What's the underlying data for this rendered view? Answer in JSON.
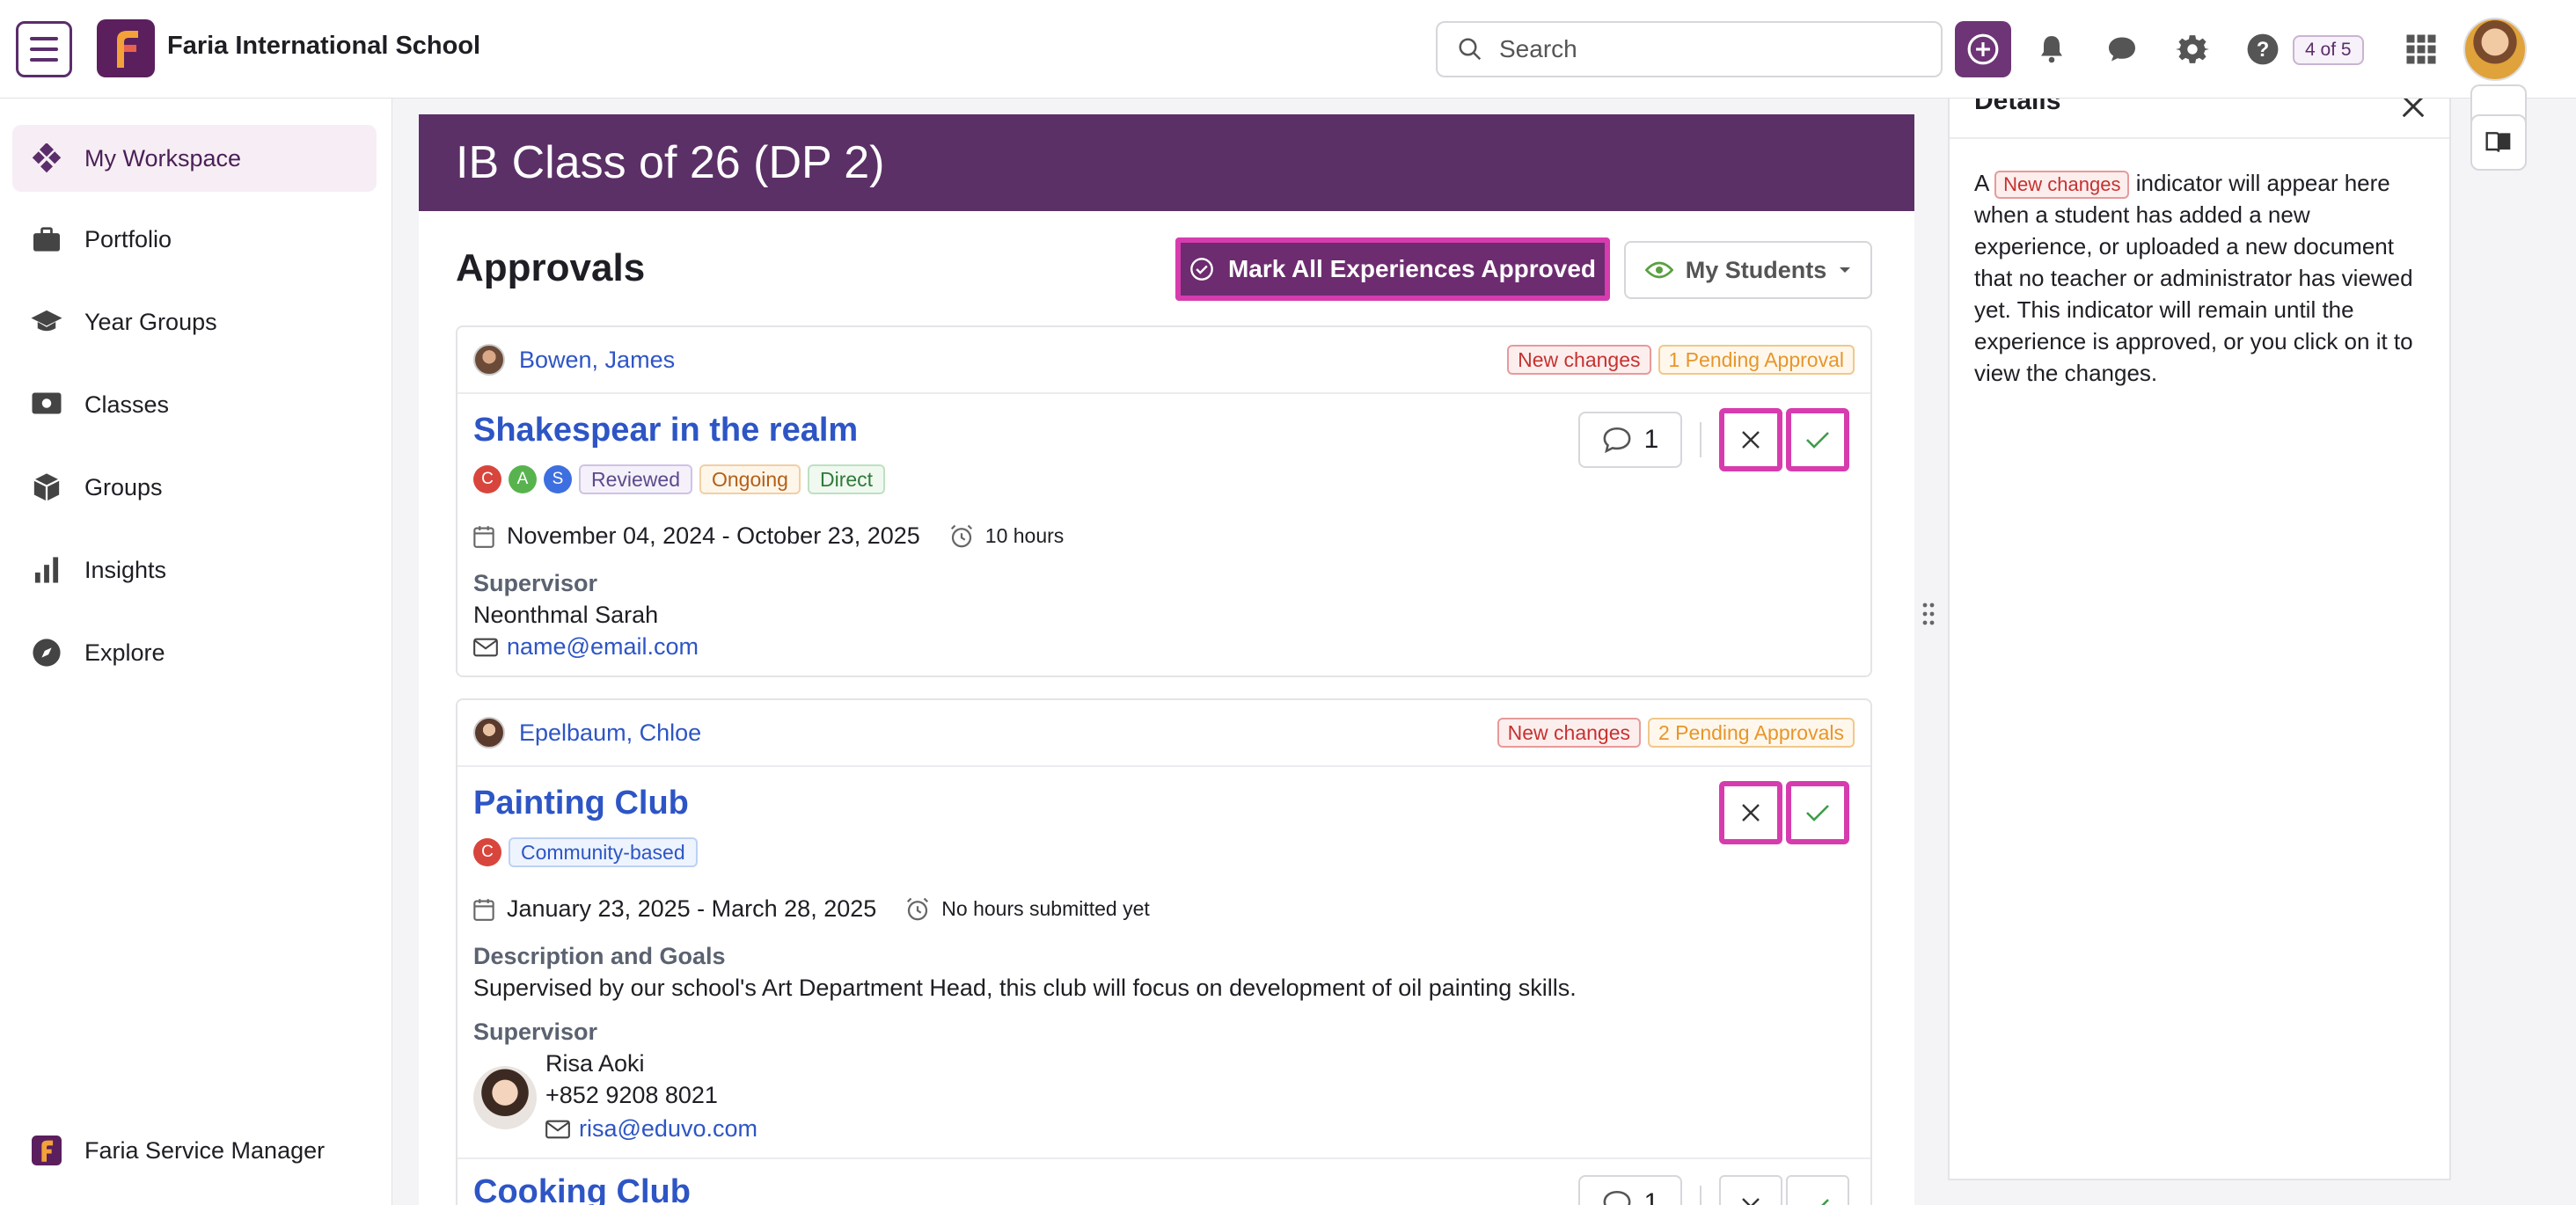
{
  "app": {
    "title": "Faria International School"
  },
  "header": {
    "search_placeholder": "Search",
    "page_counter": "4 of 5"
  },
  "sidebar": {
    "items": [
      {
        "label": "My Workspace",
        "icon": "workspace-icon",
        "active": true
      },
      {
        "label": "Portfolio",
        "icon": "briefcase-icon"
      },
      {
        "label": "Year Groups",
        "icon": "graduation-cap-icon"
      },
      {
        "label": "Classes",
        "icon": "classes-icon"
      },
      {
        "label": "Groups",
        "icon": "cube-icon"
      },
      {
        "label": "Insights",
        "icon": "bar-chart-icon"
      },
      {
        "label": "Explore",
        "icon": "compass-icon"
      }
    ],
    "footer": {
      "label": "Faria Service Manager"
    }
  },
  "main": {
    "banner_title": "IB Class of 26 (DP 2)",
    "section_title": "Approvals",
    "mark_all_label": "Mark All Experiences Approved",
    "filter_label": "My Students",
    "cards": [
      {
        "student": "Bowen, James",
        "badge_new": "New changes",
        "badge_pending": "1 Pending Approval",
        "title": "Shakespear in the realm",
        "dots": [
          "C",
          "A",
          "S"
        ],
        "tags": [
          "Reviewed",
          "Ongoing",
          "Direct"
        ],
        "dates": "November 04, 2024 - October 23, 2025",
        "hours": "10 hours",
        "comments": "1",
        "supervisor_label": "Supervisor",
        "supervisor_name": "Neonthmal Sarah",
        "supervisor_email": "name@email.com"
      },
      {
        "student": "Epelbaum, Chloe",
        "badge_new": "New changes",
        "badge_pending": "2 Pending Approvals",
        "title": "Painting Club",
        "dots": [
          "C"
        ],
        "tags": [
          "Community-based"
        ],
        "dates": "January 23, 2025 - March 28, 2025",
        "hours": "No hours submitted yet",
        "desc_label": "Description and Goals",
        "desc": "Supervised by our school's Art Department Head, this club will focus on development of oil painting skills.",
        "supervisor_label": "Supervisor",
        "supervisor_name": "Risa Aoki",
        "supervisor_phone": "+852 9208 8021",
        "supervisor_email": "risa@eduvo.com"
      },
      {
        "title": "Cooking Club",
        "comments": "1"
      }
    ]
  },
  "details": {
    "title": "Details",
    "text_prefix": "A",
    "badge": "New changes",
    "text_suffix": "indicator will appear here when a student has added a new experience, or uploaded a new document that no teacher or administrator has viewed yet. This indicator will remain until the experience is approved, or you click on it to view the changes."
  },
  "colors": {
    "brand": "#5b3066",
    "highlight": "#d63cae",
    "link": "#2d55c5"
  }
}
